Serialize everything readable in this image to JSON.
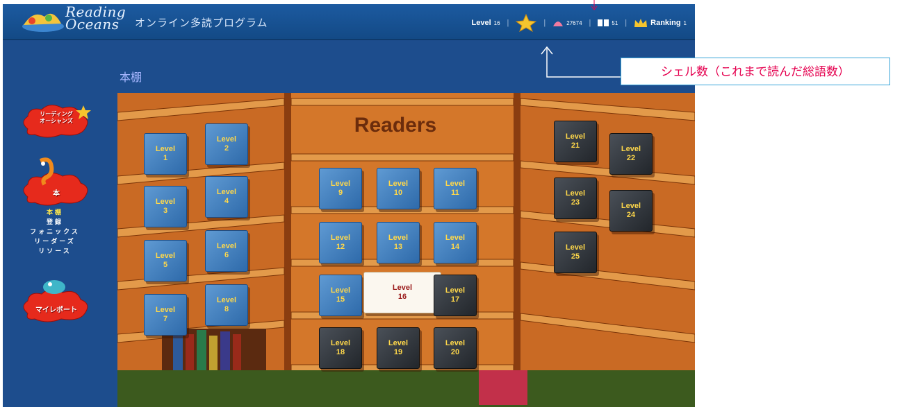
{
  "header": {
    "logo_line1": "Reading",
    "logo_line2": "Oceans",
    "subtitle": "オンライン多読プログラム",
    "level": "Level",
    "level_value": "16",
    "shells": "27674",
    "books": "51",
    "ranking_label": "Ranking",
    "ranking_value": "1"
  },
  "sidebar": {
    "btn_reading": "リーディング\nオーシャンズ",
    "btn_books": "本",
    "submenu": [
      "本棚",
      "登録",
      "フォニックス",
      "リーダーズ",
      "リソース"
    ],
    "btn_report": "マイレポート"
  },
  "main": {
    "page_title": "本棚",
    "shelf_heading": "Readers",
    "book_word": "Level",
    "books_left": [
      "1",
      "2",
      "3",
      "4",
      "5",
      "6",
      "7",
      "8"
    ],
    "books_center": [
      "9",
      "10",
      "11",
      "12",
      "13",
      "14",
      "15",
      "16",
      "17",
      "18",
      "19",
      "20"
    ],
    "books_right": [
      "21",
      "22",
      "23",
      "24",
      "25"
    ],
    "current_level": "16"
  },
  "annotation": {
    "callout": "シェル数（これまで読んだ総語数）"
  },
  "colors": {
    "header_bg": "#1c5aa0",
    "page_bg": "#1d4d8d",
    "shelf_wood": "#c9651f",
    "book_blue": "#3b78b8",
    "book_dark": "#2f343a",
    "callout_text": "#e5004f",
    "callout_border": "#36a4d8"
  }
}
